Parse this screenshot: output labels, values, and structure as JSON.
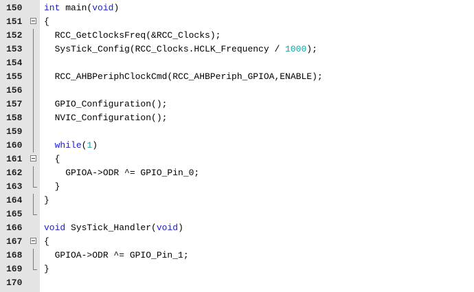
{
  "editor": {
    "lines": [
      {
        "num": "150",
        "fold": "none",
        "tokens": [
          {
            "t": "int",
            "k": "kw"
          },
          {
            "t": " main(",
            "k": "p"
          },
          {
            "t": "void",
            "k": "kw"
          },
          {
            "t": ")",
            "k": "p"
          }
        ]
      },
      {
        "num": "151",
        "fold": "open",
        "tokens": [
          {
            "t": "{",
            "k": "p"
          }
        ]
      },
      {
        "num": "152",
        "fold": "vert",
        "tokens": [
          {
            "t": "  RCC_GetClocksFreq(&RCC_Clocks);",
            "k": "p"
          }
        ]
      },
      {
        "num": "153",
        "fold": "vert",
        "tokens": [
          {
            "t": "  SysTick_Config(RCC_Clocks.HCLK_Frequency / ",
            "k": "p"
          },
          {
            "t": "1000",
            "k": "num"
          },
          {
            "t": ");",
            "k": "p"
          }
        ]
      },
      {
        "num": "154",
        "fold": "vert",
        "tokens": [
          {
            "t": "",
            "k": "p"
          }
        ]
      },
      {
        "num": "155",
        "fold": "vert",
        "tokens": [
          {
            "t": "  RCC_AHBPeriphClockCmd(RCC_AHBPeriph_GPIOA,ENABLE);",
            "k": "p"
          }
        ]
      },
      {
        "num": "156",
        "fold": "vert",
        "tokens": [
          {
            "t": "",
            "k": "p"
          }
        ]
      },
      {
        "num": "157",
        "fold": "vert",
        "tokens": [
          {
            "t": "  GPIO_Configuration();",
            "k": "p"
          }
        ]
      },
      {
        "num": "158",
        "fold": "vert",
        "tokens": [
          {
            "t": "  NVIC_Configuration();",
            "k": "p"
          }
        ]
      },
      {
        "num": "159",
        "fold": "vert",
        "tokens": [
          {
            "t": "",
            "k": "p"
          }
        ]
      },
      {
        "num": "160",
        "fold": "vert",
        "tokens": [
          {
            "t": "  ",
            "k": "p"
          },
          {
            "t": "while",
            "k": "kw"
          },
          {
            "t": "(",
            "k": "p"
          },
          {
            "t": "1",
            "k": "num"
          },
          {
            "t": ")",
            "k": "p"
          }
        ]
      },
      {
        "num": "161",
        "fold": "open",
        "tokens": [
          {
            "t": "  {",
            "k": "p"
          }
        ]
      },
      {
        "num": "162",
        "fold": "vert",
        "tokens": [
          {
            "t": "    GPIOA->ODR ^= GPIO_Pin_0;",
            "k": "p"
          }
        ]
      },
      {
        "num": "163",
        "fold": "end",
        "tokens": [
          {
            "t": "  }",
            "k": "p"
          }
        ]
      },
      {
        "num": "164",
        "fold": "vert",
        "tokens": [
          {
            "t": "}",
            "k": "p"
          }
        ]
      },
      {
        "num": "165",
        "fold": "end",
        "tokens": [
          {
            "t": "",
            "k": "p"
          }
        ]
      },
      {
        "num": "166",
        "fold": "none",
        "tokens": [
          {
            "t": "void",
            "k": "kw"
          },
          {
            "t": " SysTick_Handler(",
            "k": "p"
          },
          {
            "t": "void",
            "k": "kw"
          },
          {
            "t": ")",
            "k": "p"
          }
        ]
      },
      {
        "num": "167",
        "fold": "open",
        "tokens": [
          {
            "t": "{",
            "k": "p"
          }
        ]
      },
      {
        "num": "168",
        "fold": "vert",
        "tokens": [
          {
            "t": "  GPIOA->ODR ^= GPIO_Pin_1;",
            "k": "p"
          }
        ]
      },
      {
        "num": "169",
        "fold": "end",
        "tokens": [
          {
            "t": "}",
            "k": "p"
          }
        ]
      },
      {
        "num": "170",
        "fold": "none",
        "tokens": [
          {
            "t": "",
            "k": "p"
          }
        ]
      }
    ]
  },
  "colors": {
    "keyword": "#1b1bd1",
    "number": "#17a3a3",
    "text": "#000000",
    "gutter_bg": "#e4e4e4"
  },
  "icons": {
    "fold_open": "fold-collapse-icon",
    "fold_end": "fold-end-icon",
    "fold_line": "fold-line-icon"
  }
}
